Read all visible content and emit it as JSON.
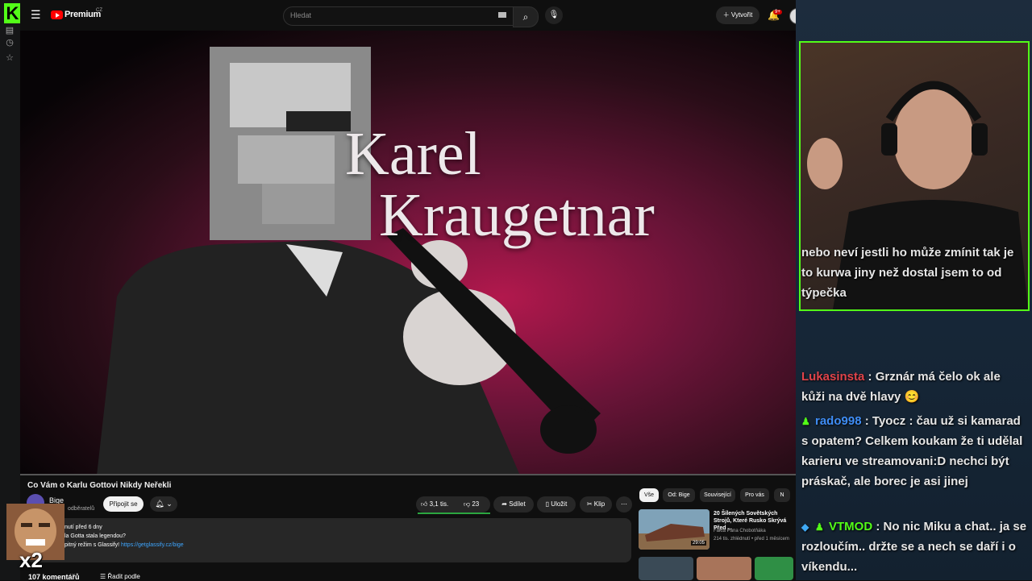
{
  "kick": {
    "logo": "K"
  },
  "youtube": {
    "brand": "Premium",
    "region": "CZ",
    "search_placeholder": "Hledat",
    "create_label": "Vytvořit",
    "notifications_badge": "9+"
  },
  "video": {
    "overlay_line1": "Karel",
    "overlay_line2": "Kraugetnar",
    "title": "Co Vám o Karlu Gottovi Nikdy Neřekli",
    "channel": "Bige",
    "subscribers": "odběratelů",
    "join_label": "Připojit se",
    "likes": "3,1 tis.",
    "dislikes": "23",
    "share_label": "Sdílet",
    "save_label": "Uložit",
    "clip_label": "Klip",
    "desc_line1": "nutí  před 6 dny",
    "desc_line2": "la Gotta stala legendou?",
    "desc_line3_prefix": "pitný režim s Glassify! ",
    "desc_link": "https://getglassify.cz/bige",
    "comments": "107 komentářů",
    "sort_label": "Řadit podle"
  },
  "emote": {
    "multiplier": "x2"
  },
  "sidebar": {
    "chips": [
      "Vše",
      "Od: Bige",
      "Související",
      "Pro vás",
      "N"
    ],
    "rec": {
      "title": "20 Šílených Sovětských Strojů, Které Rusko Skrývá Před ...",
      "channel": "Fakta Pana Chobotňáka",
      "meta": "214 tis. zhlédnutí • před 1 měsícem",
      "duration": "29:05"
    }
  },
  "chat": [
    {
      "user": "",
      "color": "#e6e6e6",
      "text": "nebo neví jestli ho může zmínit tak je to kurwa jiny než dostal jsem to od týpečka"
    },
    {
      "user": "Lukasinsta",
      "color": "#e0434a",
      "text": "Grznár má čelo ok ale kůži na dvě hlavy 😊"
    },
    {
      "user": "rado998",
      "color": "#3f8df5",
      "text": "Tyocz : čau už si kamarad s opatem? Celkem koukam že ti udělal karieru ve streamovani:D nechci být práskač, ale borec je asi jinej"
    },
    {
      "user": "VTMOD",
      "color": "#53fc18",
      "text": "No nic Miku a chat.. ja se rozloučím.. držte se a nech se daří i o víkendu..."
    }
  ]
}
